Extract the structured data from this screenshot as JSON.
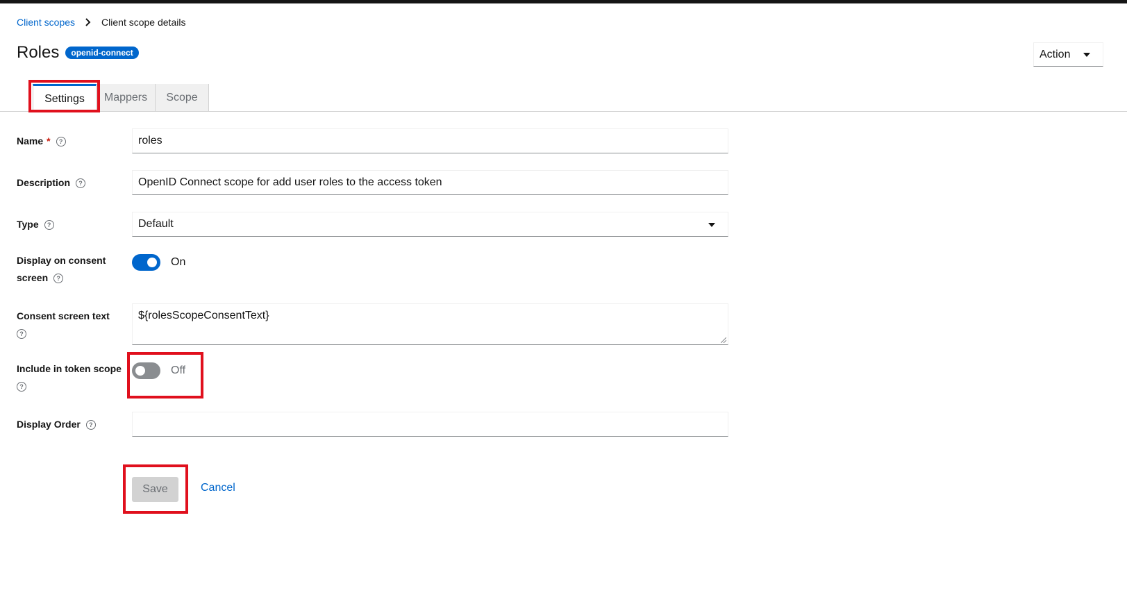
{
  "breadcrumb": {
    "parent": "Client scopes",
    "current": "Client scope details"
  },
  "header": {
    "title": "Roles",
    "badge": "openid-connect",
    "action_label": "Action"
  },
  "tabs": [
    {
      "label": "Settings",
      "active": true
    },
    {
      "label": "Mappers",
      "active": false
    },
    {
      "label": "Scope",
      "active": false
    }
  ],
  "form": {
    "name": {
      "label": "Name",
      "required_mark": "*",
      "value": "roles"
    },
    "description": {
      "label": "Description",
      "value": "OpenID Connect scope for add user roles to the access token"
    },
    "type": {
      "label": "Type",
      "value": "Default"
    },
    "display_on_consent": {
      "label_line1": "Display on consent",
      "label_line2": "screen",
      "state": "On"
    },
    "consent_text": {
      "label": "Consent screen text",
      "value": "${rolesScopeConsentText}"
    },
    "include_in_token": {
      "label": "Include in token scope",
      "state": "Off"
    },
    "display_order": {
      "label": "Display Order",
      "value": ""
    },
    "help_glyph": "?"
  },
  "buttons": {
    "save": "Save",
    "cancel": "Cancel"
  },
  "colors": {
    "accent": "#0066cc",
    "highlight": "#e0101d",
    "required": "#c9190b"
  }
}
